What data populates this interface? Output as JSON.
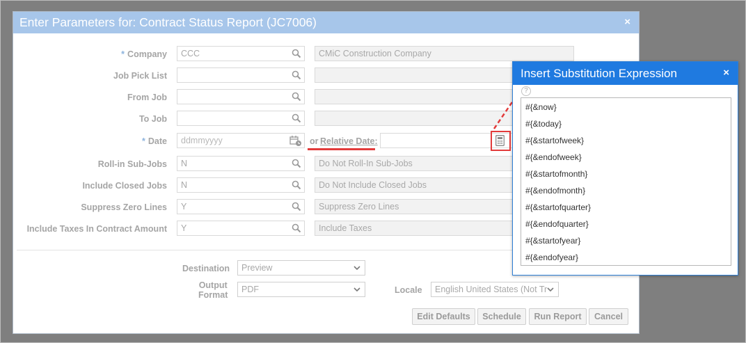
{
  "dialog": {
    "title": "Enter Parameters for: Contract Status Report (JC7006)",
    "close": "×"
  },
  "fields": {
    "company": {
      "required": "*",
      "label": "Company",
      "value": "CCC",
      "description": "CMiC Construction Company"
    },
    "job_pick_list": {
      "label": "Job Pick List",
      "value": "",
      "description": ""
    },
    "from_job": {
      "label": "From Job",
      "value": "",
      "description": ""
    },
    "to_job": {
      "label": "To Job",
      "value": "",
      "description": ""
    },
    "date": {
      "required": "*",
      "label": "Date",
      "placeholder": "ddmmyyyy",
      "or_text": "or",
      "relative_label": "Relative Date:",
      "relative_value": ""
    },
    "rollin": {
      "label": "Roll-in Sub-Jobs",
      "value": "N",
      "description": "Do Not Roll-In Sub-Jobs"
    },
    "include_closed": {
      "label": "Include Closed Jobs",
      "value": "N",
      "description": "Do Not Include Closed Jobs"
    },
    "suppress_zero": {
      "label": "Suppress Zero Lines",
      "value": "Y",
      "description": "Suppress Zero Lines"
    },
    "include_taxes": {
      "label": "Include Taxes In Contract Amount",
      "value": "Y",
      "description": "Include Taxes"
    }
  },
  "output": {
    "destination_label": "Destination",
    "destination_value": "Preview",
    "format_label_1": "Output",
    "format_label_2": "Format",
    "format_value": "PDF",
    "locale_label": "Locale",
    "locale_value": "English United States (Not Tr"
  },
  "buttons": {
    "edit_defaults": "Edit Defaults",
    "schedule": "Schedule",
    "run_report": "Run Report",
    "cancel": "Cancel"
  },
  "popup": {
    "title": "Insert Substitution Expression",
    "close": "×",
    "help": "?",
    "expressions": [
      "#{&now}",
      "#{&today}",
      "#{&startofweek}",
      "#{&endofweek}",
      "#{&startofmonth}",
      "#{&endofmonth}",
      "#{&startofquarter}",
      "#{&endofquarter}",
      "#{&startofyear}",
      "#{&endofyear}"
    ]
  },
  "colors": {
    "dialog_header": "#a7c6ea",
    "popup_header": "#1f7ae0",
    "annotation_red": "#e23b3b"
  }
}
